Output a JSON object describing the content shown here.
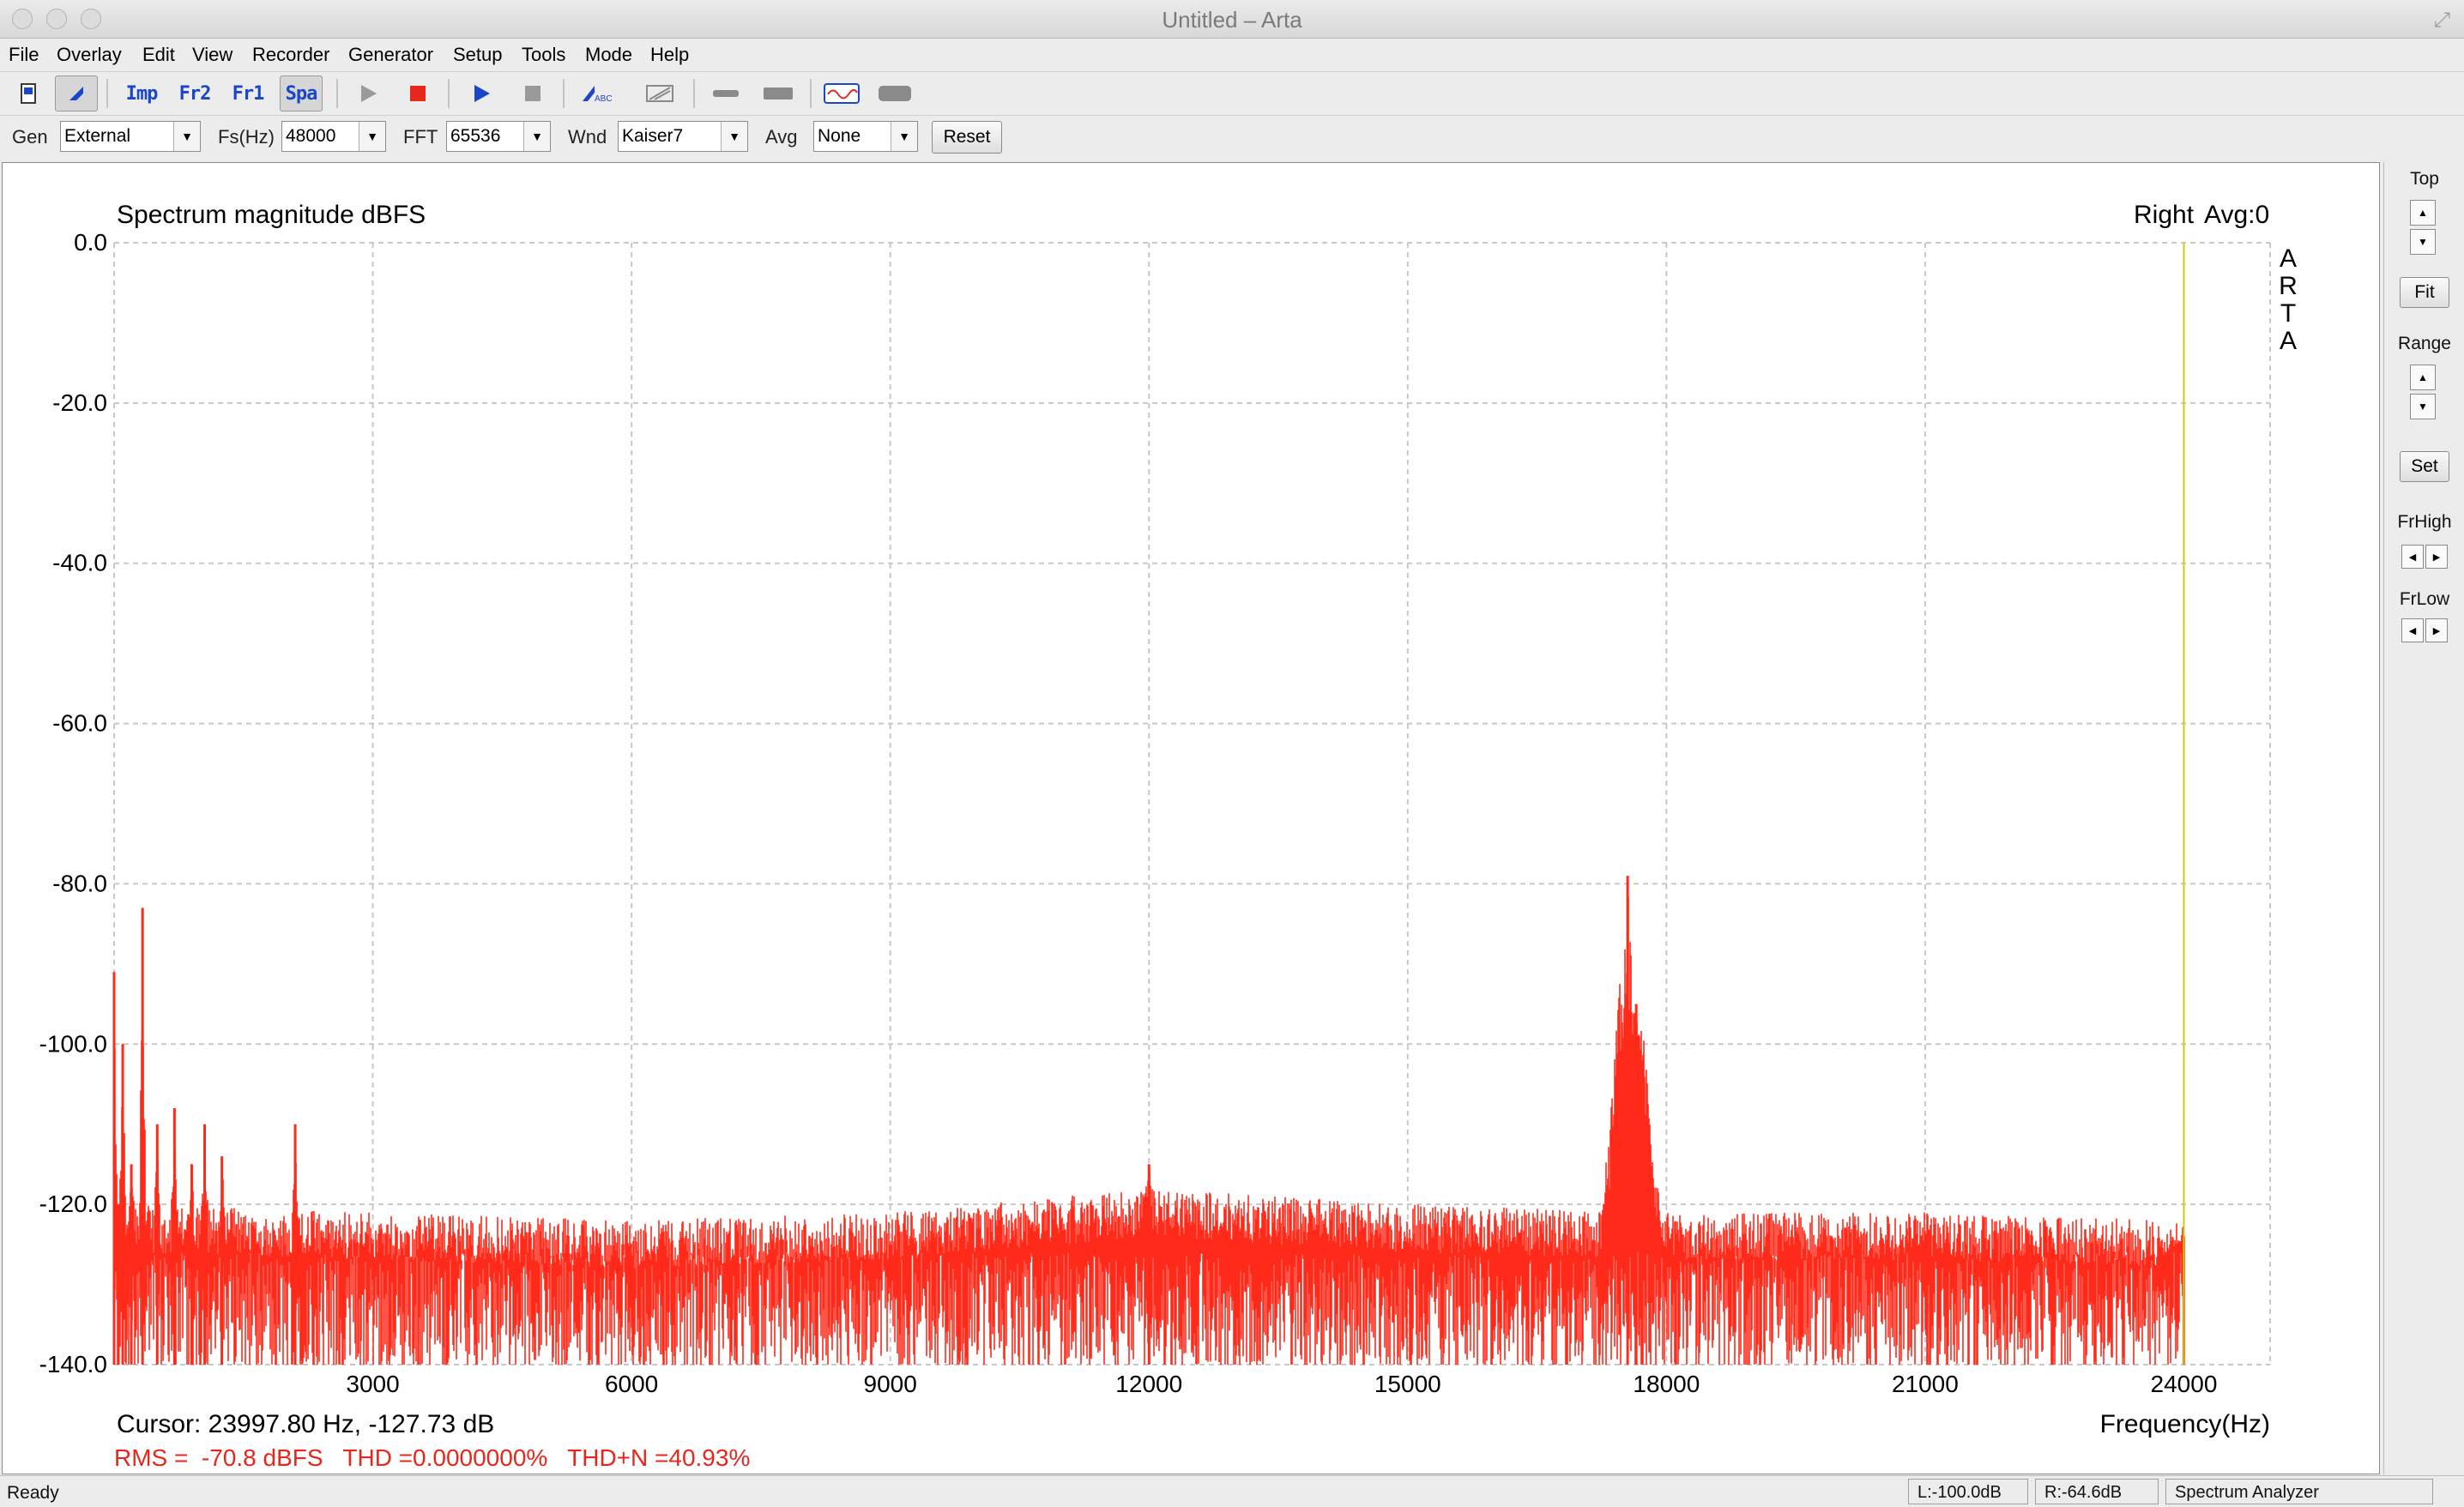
{
  "window": {
    "title": "Untitled – Arta"
  },
  "menu": [
    "File",
    "Overlay",
    "Edit",
    "View",
    "Recorder",
    "Generator",
    "Setup",
    "Tools",
    "Mode",
    "Help"
  ],
  "toolbar": {
    "imp_label": "Imp",
    "fr2_label": "Fr2",
    "fr1_label": "Fr1",
    "spa_label": "Spa",
    "active_mode": "Spa"
  },
  "controls": {
    "gen": {
      "label": "Gen",
      "value": "External"
    },
    "fs": {
      "label": "Fs(Hz)",
      "value": "48000"
    },
    "fft": {
      "label": "FFT",
      "value": "65536"
    },
    "wnd": {
      "label": "Wnd",
      "value": "Kaiser7"
    },
    "avg": {
      "label": "Avg",
      "value": "None"
    },
    "reset_label": "Reset"
  },
  "chart_data": {
    "type": "line",
    "title": "Spectrum magnitude dBFS",
    "channel_label": "Right",
    "avg_label": "Avg:0",
    "watermark": "ARTA",
    "xlabel": "Frequency(Hz)",
    "xlim": [
      0,
      25000
    ],
    "ylim": [
      -140,
      0
    ],
    "x_ticks": [
      "3000",
      "6000",
      "9000",
      "12000",
      "15000",
      "18000",
      "21000",
      "24000"
    ],
    "x_tick_values": [
      3000,
      6000,
      9000,
      12000,
      15000,
      18000,
      21000,
      24000
    ],
    "y_ticks": [
      "0.0",
      "-20.0",
      "-40.0",
      "-60.0",
      "-80.0",
      "-100.0",
      "-120.0",
      "-140.0"
    ],
    "y_tick_values": [
      0,
      -20,
      -40,
      -60,
      -80,
      -100,
      -120,
      -140
    ],
    "grid": true,
    "series": [
      {
        "color": "#ff2a1a",
        "peak_points": [
          [
            0,
            -91
          ],
          [
            50,
            -120
          ],
          [
            100,
            -100
          ],
          [
            200,
            -115
          ],
          [
            330,
            -83
          ],
          [
            500,
            -110
          ],
          [
            700,
            -108
          ],
          [
            900,
            -115
          ],
          [
            1050,
            -110
          ],
          [
            1250,
            -114
          ],
          [
            2100,
            -110
          ],
          [
            12000,
            -115
          ],
          [
            17550,
            -79
          ],
          [
            17650,
            -95
          ],
          [
            24000,
            -124
          ]
        ],
        "noise_envelope_top": [
          [
            0,
            -120
          ],
          [
            3000,
            -121
          ],
          [
            6000,
            -122
          ],
          [
            9000,
            -121
          ],
          [
            12000,
            -118
          ],
          [
            15000,
            -120
          ],
          [
            18000,
            -121
          ],
          [
            21000,
            -121
          ],
          [
            24000,
            -122
          ]
        ],
        "floor": -140
      }
    ],
    "cursor_marker_x": 24000,
    "cursor_readout": "Cursor: 23997.80 Hz, -127.73 dB",
    "measurements": "RMS =  -70.8 dBFS   THD =0.0000000%   THD+N =40.93%"
  },
  "sidepanel": {
    "top_label": "Top",
    "fit_label": "Fit",
    "range_label": "Range",
    "set_label": "Set",
    "frhigh_label": "FrHigh",
    "frlow_label": "FrLow"
  },
  "status": {
    "text": "Ready",
    "left_level": "L:-100.0dB",
    "right_level": "R:-64.6dB",
    "mode": "Spectrum Analyzer"
  }
}
